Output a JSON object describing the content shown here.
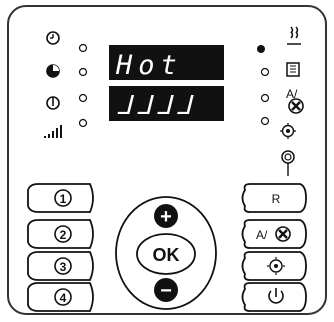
{
  "display": {
    "line1": "Hot",
    "line2": "ᒧᒧᒧᒧ"
  },
  "program_buttons": [
    "1",
    "2",
    "3",
    "4"
  ],
  "center_control": {
    "plus": "+",
    "ok_label": "OK",
    "minus": "−"
  },
  "right_buttons": {
    "reset_label": "R",
    "auto_fan_label": "A/",
    "fan_icon": "fan-icon",
    "power_icon": "power-icon"
  },
  "right_indicators": {
    "auto_fan_label": "A/"
  },
  "left_icons": [
    "clock-icon",
    "pie-timer-icon",
    "thermometer-icon",
    "signal-bars-icon"
  ],
  "right_icons": [
    "steam-heat-icon",
    "residual-heat-icon",
    "auto-fan-icon",
    "fan-speed-icon",
    "filter-ring-icon"
  ],
  "colors": {
    "panel_border": "#333333",
    "display_bg": "#111111",
    "display_text": "#ffffff",
    "button_fill": "#ffffff",
    "led_active": "#111111"
  }
}
